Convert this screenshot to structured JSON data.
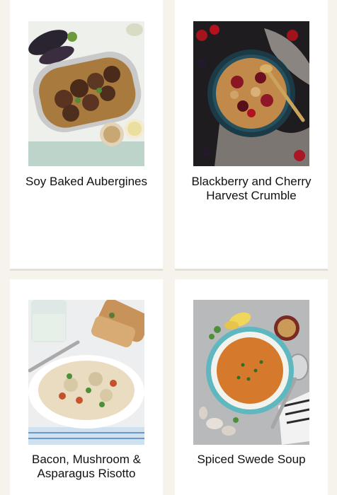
{
  "recipes": [
    {
      "title": "Soy Baked Aubergines",
      "image": "soy-baked-aubergines-photo"
    },
    {
      "title": "Blackberry and Cherry Harvest Crumble",
      "image": "blackberry-cherry-crumble-photo"
    },
    {
      "title": "Bacon, Mushroom & Asparagus Risotto",
      "image": "bacon-mushroom-asparagus-risotto-photo"
    },
    {
      "title": "Spiced Swede Soup",
      "image": "spiced-swede-soup-photo"
    }
  ],
  "colors": {
    "background": "#f6f3ec",
    "card": "#ffffff",
    "divider": "#e3e0d8",
    "text": "#111111"
  }
}
